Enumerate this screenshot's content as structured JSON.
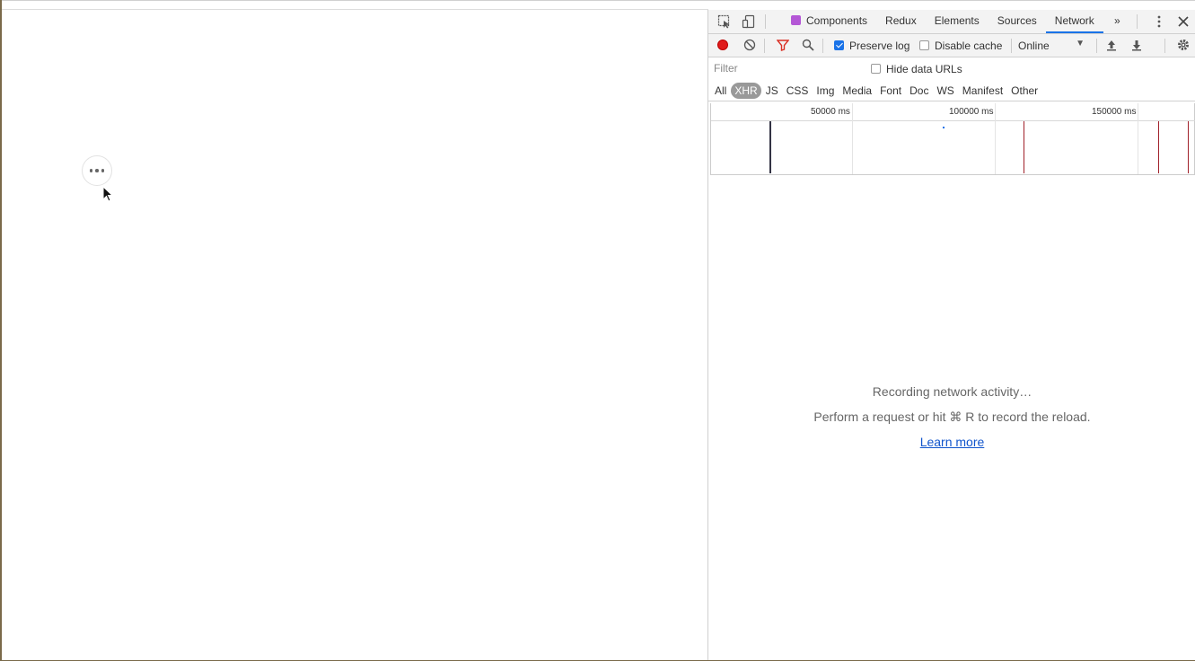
{
  "devtools": {
    "tabs": [
      "Components",
      "Redux",
      "Elements",
      "Sources",
      "Network"
    ],
    "active_tab": "Network",
    "more_tabs_label": "»",
    "toolbar": {
      "preserve_log_label": "Preserve log",
      "preserve_log_checked": true,
      "disable_cache_label": "Disable cache",
      "disable_cache_checked": false,
      "throttling_value": "Online"
    },
    "filter": {
      "placeholder": "Filter",
      "hide_data_urls_label": "Hide data URLs"
    },
    "resource_types": [
      "All",
      "XHR",
      "JS",
      "CSS",
      "Img",
      "Media",
      "Font",
      "Doc",
      "WS",
      "Manifest",
      "Other"
    ],
    "selected_type": "XHR",
    "timeline": {
      "ticks": [
        "50000 ms",
        "100000 ms",
        "150000 ms"
      ]
    },
    "empty_state": {
      "title": "Recording network activity…",
      "hint": "Perform a request or hit ⌘ R to record the reload.",
      "link": "Learn more"
    },
    "colors": {
      "accent": "#1a73e8",
      "record": "#e01b1b",
      "timeline_mark": "#a0202a"
    }
  }
}
